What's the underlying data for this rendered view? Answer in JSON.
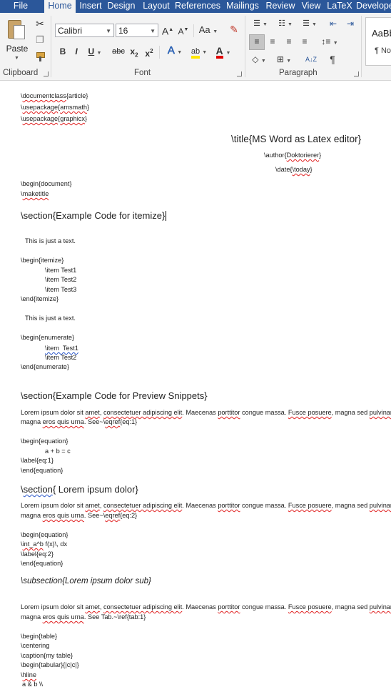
{
  "tabs": [
    "File",
    "Home",
    "Insert",
    "Design",
    "Layout",
    "References",
    "Mailings",
    "Review",
    "View",
    "LaTeX",
    "Developer"
  ],
  "active_tab": "Home",
  "clipboard": {
    "paste_label": "Paste",
    "group_label": "Clipboard"
  },
  "font": {
    "name": "Calibri",
    "size": "16",
    "group_label": "Font",
    "grow": "A",
    "shrink": "A",
    "case": "Aa",
    "bold": "B",
    "italic": "I",
    "underline": "U",
    "strike": "abc",
    "sub": "x",
    "sub_small": "2",
    "sup": "x",
    "sup_small": "2",
    "effects": "A",
    "color": "A"
  },
  "paragraph": {
    "group_label": "Paragraph",
    "sort": "A↓Z",
    "pilcrow": "¶"
  },
  "styles": {
    "preview": "AaBb",
    "name": "¶ No"
  },
  "doc": {
    "l1a": "\\",
    "l1b": "documentclass",
    "l1c": "{article}",
    "l2a": "\\",
    "l2b": "usepackage",
    "l2c": "{",
    "l2d": "amsmath",
    "l2e": "}",
    "l3a": "\\",
    "l3b": "usepackage",
    "l3c": "{",
    "l3d": "graphicx",
    "l3e": "}",
    "title": "\\title{MS Word as Latex editor}",
    "author_a": "\\author{",
    "author_b": "Doktorierer",
    "author_c": "}",
    "date_a": "\\date{",
    "date_b": "\\today",
    "date_c": "}",
    "begin_doc": "\\begin{document}",
    "maketitle_a": "\\",
    "maketitle_b": "maketitle",
    "sec1": "\\section{Example Code for itemize}",
    "text1": "This is just a text.",
    "begin_itemize": "\\begin{itemize}",
    "item1": "\\item Test1",
    "item2": "\\item Test2",
    "item3": "\\item Test3",
    "end_itemize": "\\end{itemize}",
    "text2": "This is just a text.",
    "begin_enum": "\\begin{enumerate}",
    "enum1": "\\item  Test1",
    "enum2": "\\item Test2",
    "end_enum": "\\end{enumerate}",
    "sec2": "\\section{Example Code for Preview Snippets}",
    "lorem_a": "Lorem ipsum dolor sit ",
    "lorem_b": "amet",
    "lorem_c": ", ",
    "lorem_d": "consectetuer adipiscing elit",
    "lorem_e": ". Maecenas ",
    "lorem_f": "porttitor",
    "lorem_g": " congue massa. ",
    "lorem_h": "Fusce posuere",
    "lorem_i": ", magna sed ",
    "lorem_j": "pulvinar",
    "magna1_a": "magna ",
    "magna1_b": "eros quis urna",
    "magna1_c": ". See~\\",
    "magna1_d": "eqref",
    "magna1_e": "{eq:1}",
    "begin_eq": "\\begin{equation}",
    "eq_abc": "a + b = c",
    "label1": "\\label{eq:1}",
    "end_eq": "\\end{equation}",
    "sec3_a": "\\",
    "sec3_b": "section",
    "sec3_c": "{ Lorem ipsum dolor}",
    "magna2_c": ". See~\\",
    "magna2_d": "eqref",
    "magna2_e": "{eq:2}",
    "begin_eq2": "\\begin{equation}",
    "int_a": "\\",
    "int_b": "int_a^b",
    "int_c": " f(x)\\, dx",
    "label2": "\\label{eq:2}",
    "end_eq2": "\\end{equation}",
    "subsec": "\\subsection{Lorem ipsum dolor sub}",
    "magna3_c": ". See Tab.~\\ref{tab:1}",
    "begin_table": "\\begin{table}",
    "centering": "\\centering",
    "caption": "\\caption{my table}",
    "tabular": "\\begin{tabular}{|c|c|}",
    "hline_a": "\\",
    "hline_b": "hline",
    "row": "a & b \\\\"
  }
}
